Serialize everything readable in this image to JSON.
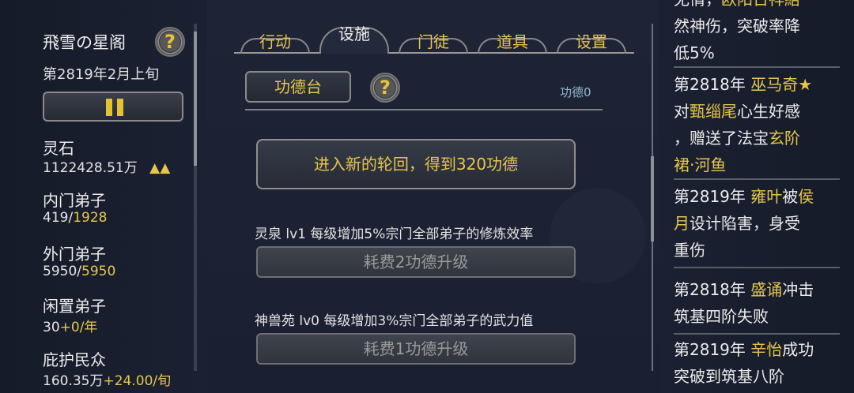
{
  "sidebar": {
    "sect_name": "飛雪の星阁",
    "help_symbol": "?",
    "date": "第2819年2月上旬",
    "pause_icon": "pause-icon",
    "stats": [
      {
        "label": "灵石",
        "value": "1122428.51万",
        "extra": "▲▲"
      },
      {
        "label": "内门弟子",
        "value": "419/",
        "extra": "1928"
      },
      {
        "label": "外门弟子",
        "value": "5950/",
        "extra": "5950"
      },
      {
        "label": "闲置弟子",
        "value": "30",
        "extra": "+0/年"
      },
      {
        "label": "庇护民众",
        "value": "160.35万",
        "extra": "+24.00/旬"
      }
    ]
  },
  "tabs": [
    {
      "label": "行动"
    },
    {
      "label": "设施"
    },
    {
      "label": "门徒"
    },
    {
      "label": "道具"
    },
    {
      "label": "设置"
    }
  ],
  "facility": {
    "title": "功德台",
    "help_symbol": "?",
    "merit_label": "功德0",
    "reincarnate_button": "进入新的轮回，得到320功德",
    "items": [
      {
        "desc": "灵泉 lv1 每级增加5%宗门全部弟子的修炼效率",
        "button": "耗费2功德升级"
      },
      {
        "desc": "神兽苑 lv0 每级增加3%宗门全部弟子的武力值",
        "button": "耗费1功德升级"
      }
    ]
  },
  "log": {
    "entry0": {
      "l1a": "无情，",
      "l1b": "欧阳日祥結",
      "l2": "然神伤，突破率降",
      "l3": "低5%"
    },
    "entry1": {
      "l1a": "第2818年 ",
      "l1b": "巫马奇★",
      "l2a": "对",
      "l2b": "甄缁尾",
      "l2c": "心生好感",
      "l3a": "，赠送了法宝",
      "l3b": "玄阶",
      "l4": "裙·河鱼"
    },
    "entry2": {
      "l1a": "第2819年 ",
      "l1b": "雍叶",
      "l1c": "被",
      "l1d": "侯",
      "l2a": "月",
      "l2b": "设计陷害，身受",
      "l3": "重伤"
    },
    "entry3": {
      "l1a": "第2818年 ",
      "l1b": "盛诵",
      "l1c": "冲击",
      "l2": "筑基四阶失败"
    },
    "entry4": {
      "l1a": "第2819年 ",
      "l1b": "辛怡",
      "l1c": "成功",
      "l2": "突破到筑基八阶"
    }
  },
  "colors": {
    "accent_gold": "#e6c74a",
    "background": "#1c2233",
    "merit_blue": "#8fb8c9"
  }
}
